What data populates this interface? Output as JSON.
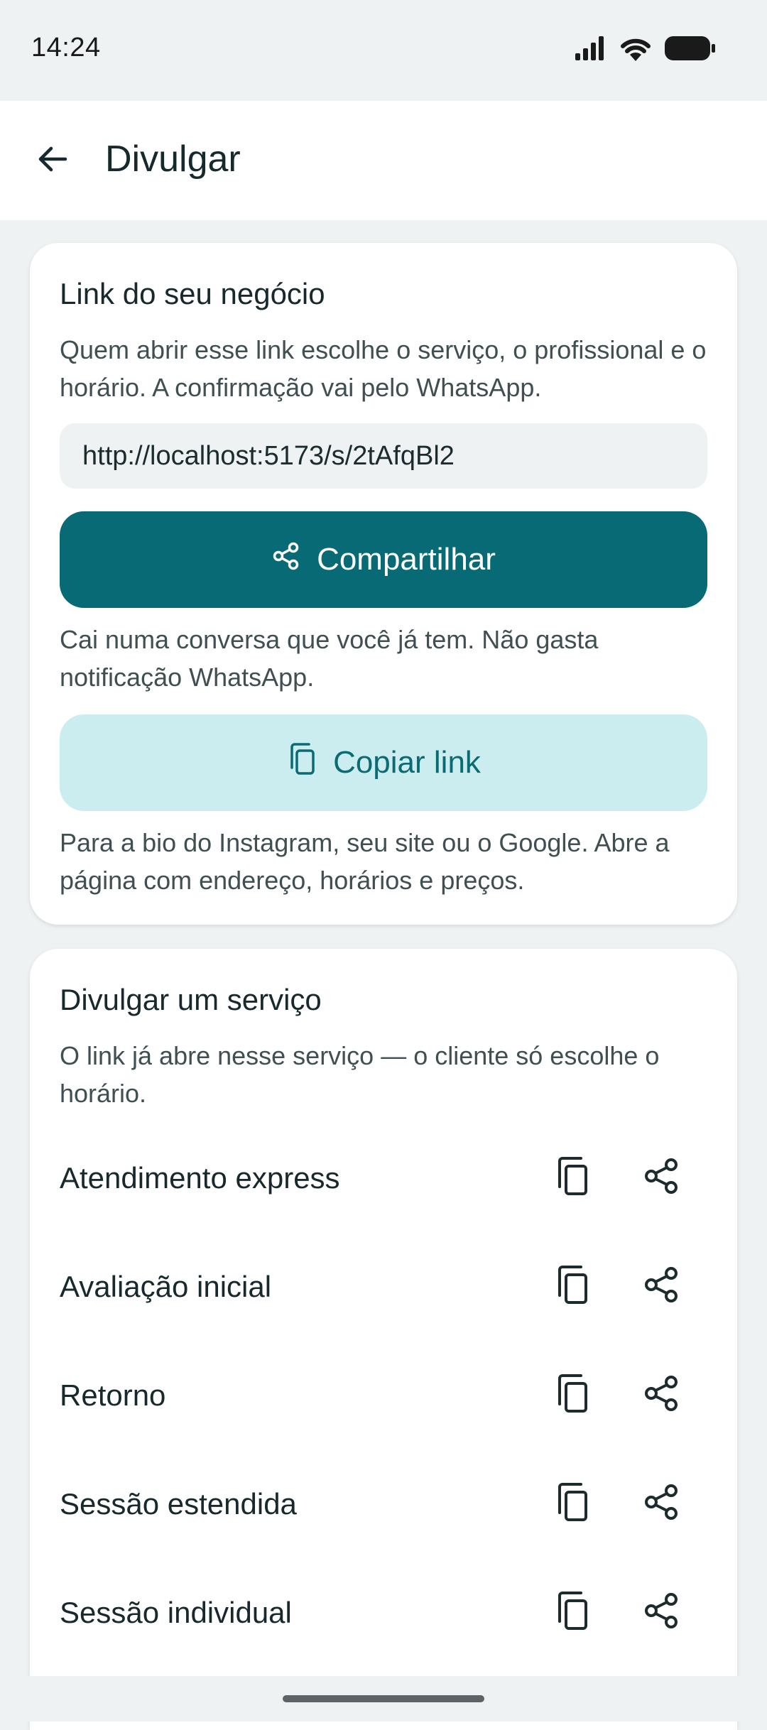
{
  "status_bar": {
    "time": "14:24"
  },
  "app_bar": {
    "title": "Divulgar"
  },
  "business_link": {
    "title": "Link do seu negócio",
    "description": "Quem abrir esse link escolhe o serviço, o profissional e o horário. A confirmação vai pelo WhatsApp.",
    "url": "http://localhost:5173/s/2tAfqBl2",
    "share_label": "Compartilhar",
    "share_hint": "Cai numa conversa que você já tem. Não gasta notificação WhatsApp.",
    "copy_label": "Copiar link",
    "copy_hint": "Para a bio do Instagram, seu site ou o Google. Abre a página com endereço, horários e preços."
  },
  "service_share": {
    "title": "Divulgar um serviço",
    "description": "O link já abre nesse serviço — o cliente só escolhe o horário.",
    "services": [
      {
        "name": "Atendimento express"
      },
      {
        "name": "Avaliação inicial"
      },
      {
        "name": "Retorno"
      },
      {
        "name": "Sessão estendida"
      },
      {
        "name": "Sessão individual"
      }
    ]
  },
  "icons": {
    "back": "arrow-left-icon",
    "share": "share-icon",
    "copy": "copy-icon",
    "signal": "signal-icon",
    "wifi": "wifi-icon",
    "battery": "battery-icon"
  },
  "colors": {
    "primary": "#076a75",
    "primary_container": "#ccedf0",
    "background": "#eef2f2",
    "surface": "#ffffff"
  }
}
